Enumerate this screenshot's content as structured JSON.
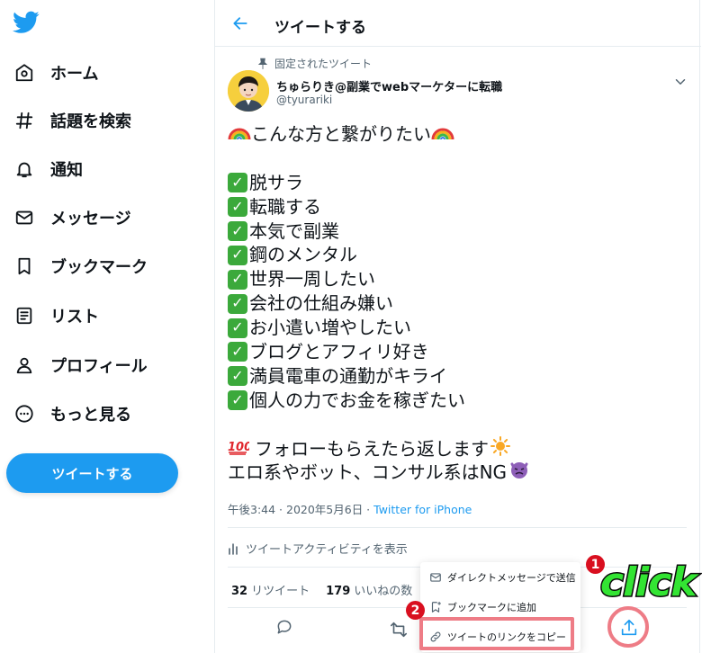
{
  "sidebar": {
    "items": [
      {
        "label": "ホーム",
        "icon": "home-icon"
      },
      {
        "label": "話題を検索",
        "icon": "hashtag-icon"
      },
      {
        "label": "通知",
        "icon": "bell-icon"
      },
      {
        "label": "メッセージ",
        "icon": "mail-icon"
      },
      {
        "label": "ブックマーク",
        "icon": "bookmark-icon"
      },
      {
        "label": "リスト",
        "icon": "list-icon"
      },
      {
        "label": "プロフィール",
        "icon": "person-icon"
      },
      {
        "label": "もっと見る",
        "icon": "more-icon"
      }
    ],
    "tweet_button": "ツイートする"
  },
  "header": {
    "title": "ツイートする"
  },
  "tweet": {
    "pinned_label": "固定されたツイート",
    "author_name": "ちゅらりき@副業でwebマーケターに転職",
    "author_handle": "@tyurariki",
    "text": {
      "intro": "こんな方と繋がりたい",
      "checklist": [
        "脱サラ",
        "転職する",
        "本気で副業",
        "鋼のメンタル",
        "世界一周したい",
        "会社の仕組み嫌い",
        "お小遣い増やしたい",
        "ブログとアフィリ好き",
        "満員電車の通勤がキライ",
        "個人の力でお金を稼ぎたい"
      ],
      "closing_1": "フォローもらえたら返します",
      "closing_2": "エロ系やボット、コンサル系はNG"
    },
    "timestamp": "午後3:44 · 2020年5月6日 · ",
    "source": "Twitter for iPhone",
    "activity_label": "ツイートアクティビティを表示",
    "retweet_count": "32",
    "retweet_label": "リツイート",
    "like_count": "179",
    "like_label": "いいねの数"
  },
  "share_menu": {
    "items": [
      {
        "label": "ダイレクトメッセージで送信",
        "icon": "mail-icon"
      },
      {
        "label": "ブックマークに追加",
        "icon": "bookmark-add-icon"
      },
      {
        "label": "ツイートのリンクをコピー",
        "icon": "link-icon"
      }
    ]
  },
  "annotations": {
    "step1": "1",
    "step2": "2",
    "click_label": "click"
  },
  "colors": {
    "accent": "#1d9bf0",
    "highlight": "#ee7c86",
    "badge": "#d90f1f",
    "click_text": "#33e433"
  }
}
